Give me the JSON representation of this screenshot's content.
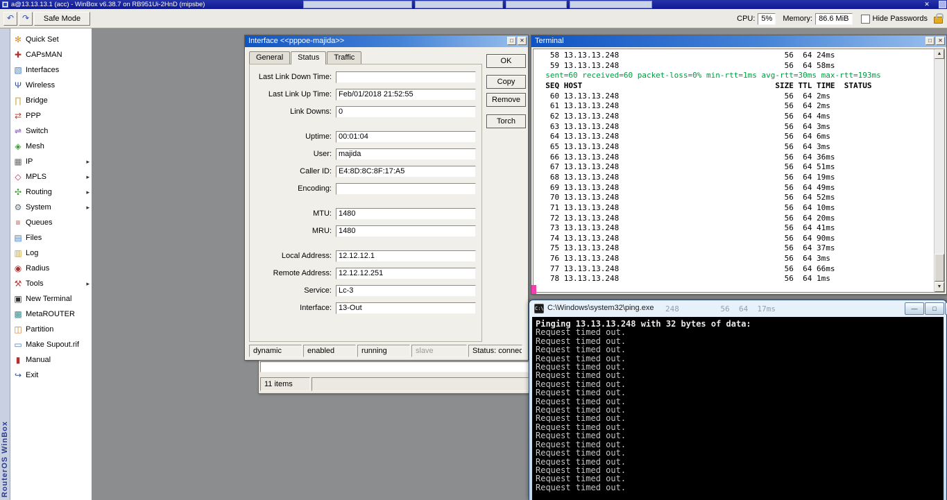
{
  "title_bar": {
    "title": "a@13.13.13.1 (acc) - WinBox v6.38.7 on RB951Ui-2HnD (mipsbe)"
  },
  "toolbar": {
    "safe_mode_label": "Safe Mode",
    "cpu_label": "CPU:",
    "cpu_value": "5%",
    "memory_label": "Memory:",
    "memory_value": "86.6 MiB",
    "hide_passwords_label": "Hide Passwords"
  },
  "brand": {
    "vertical_text": "RouterOS WinBox"
  },
  "sidebar": {
    "items": [
      {
        "label": "Quick Set",
        "icon": "quickset-icon",
        "glyph": "✻",
        "color": "#d88f2a",
        "has_submenu": false
      },
      {
        "label": "CAPsMAN",
        "icon": "capsman-icon",
        "glyph": "✚",
        "color": "#b03030",
        "has_submenu": false
      },
      {
        "label": "Interfaces",
        "icon": "interfaces-icon",
        "glyph": "▧",
        "color": "#3f7ec0",
        "has_submenu": false
      },
      {
        "label": "Wireless",
        "icon": "wireless-icon",
        "glyph": "Ψ",
        "color": "#2b4fa0",
        "has_submenu": false
      },
      {
        "label": "Bridge",
        "icon": "bridge-icon",
        "glyph": "∏",
        "color": "#caa23a",
        "has_submenu": false
      },
      {
        "label": "PPP",
        "icon": "ppp-icon",
        "glyph": "⇄",
        "color": "#b04a3a",
        "has_submenu": false
      },
      {
        "label": "Switch",
        "icon": "switch-icon",
        "glyph": "⇌",
        "color": "#7a4fb0",
        "has_submenu": false
      },
      {
        "label": "Mesh",
        "icon": "mesh-icon",
        "glyph": "◈",
        "color": "#3f9c35",
        "has_submenu": false
      },
      {
        "label": "IP",
        "icon": "ip-icon",
        "glyph": "▦",
        "color": "#6a6a6a",
        "has_submenu": true
      },
      {
        "label": "MPLS",
        "icon": "mpls-icon",
        "glyph": "◇",
        "color": "#b03060",
        "has_submenu": true
      },
      {
        "label": "Routing",
        "icon": "routing-icon",
        "glyph": "✣",
        "color": "#3f9c35",
        "has_submenu": true
      },
      {
        "label": "System",
        "icon": "system-icon",
        "glyph": "⚙",
        "color": "#5a6a7a",
        "has_submenu": true
      },
      {
        "label": "Queues",
        "icon": "queues-icon",
        "glyph": "≡",
        "color": "#b04a3a",
        "has_submenu": false
      },
      {
        "label": "Files",
        "icon": "files-icon",
        "glyph": "▤",
        "color": "#3f7ec0",
        "has_submenu": false
      },
      {
        "label": "Log",
        "icon": "log-icon",
        "glyph": "▥",
        "color": "#caa23a",
        "has_submenu": false
      },
      {
        "label": "Radius",
        "icon": "radius-icon",
        "glyph": "◉",
        "color": "#b03030",
        "has_submenu": false
      },
      {
        "label": "Tools",
        "icon": "tools-icon",
        "glyph": "⚒",
        "color": "#c23b3b",
        "has_submenu": true
      },
      {
        "label": "New Terminal",
        "icon": "terminal-icon",
        "glyph": "▣",
        "color": "#303030",
        "has_submenu": false
      },
      {
        "label": "MetaROUTER",
        "icon": "metarouter-icon",
        "glyph": "▩",
        "color": "#3a8a8a",
        "has_submenu": false
      },
      {
        "label": "Partition",
        "icon": "partition-icon",
        "glyph": "◫",
        "color": "#d07a2a",
        "has_submenu": false
      },
      {
        "label": "Make Supout.rif",
        "icon": "supout-icon",
        "glyph": "▭",
        "color": "#3f7ec0",
        "has_submenu": false
      },
      {
        "label": "Manual",
        "icon": "manual-icon",
        "glyph": "▮",
        "color": "#b03030",
        "has_submenu": false
      },
      {
        "label": "Exit",
        "icon": "exit-icon",
        "glyph": "↪",
        "color": "#2b4fa0",
        "has_submenu": false
      }
    ]
  },
  "interface_dialog": {
    "title": "Interface <<pppoe-majida>>",
    "tabs": [
      {
        "label": "General",
        "active": false
      },
      {
        "label": "Status",
        "active": true
      },
      {
        "label": "Traffic",
        "active": false
      }
    ],
    "action_buttons": [
      "OK",
      "Copy",
      "Remove",
      "Torch"
    ],
    "fields": [
      {
        "label": "Last Link Down Time:",
        "value": ""
      },
      {
        "label": "Last Link Up Time:",
        "value": "Feb/01/2018 21:52:55"
      },
      {
        "label": "Link Downs:",
        "value": "0"
      },
      {
        "label": "Uptime:",
        "value": "00:01:04"
      },
      {
        "label": "User:",
        "value": "majida"
      },
      {
        "label": "Caller ID:",
        "value": "E4:8D:8C:8F:17:A5"
      },
      {
        "label": "Encoding:",
        "value": ""
      },
      {
        "label": "MTU:",
        "value": "1480"
      },
      {
        "label": "MRU:",
        "value": "1480"
      },
      {
        "label": "Local Address:",
        "value": "12.12.12.1"
      },
      {
        "label": "Remote Address:",
        "value": "12.12.12.251"
      },
      {
        "label": "Service:",
        "value": "Lc-3"
      },
      {
        "label": "Interface:",
        "value": "13-Out"
      }
    ],
    "footer_flags": [
      {
        "label": "dynamic",
        "muted": false
      },
      {
        "label": "enabled",
        "muted": false
      },
      {
        "label": "running",
        "muted": false
      },
      {
        "label": "slave",
        "muted": true
      },
      {
        "label": "Status: connected",
        "muted": false
      }
    ]
  },
  "ppp_window_fragment": {
    "items_count": "11 items"
  },
  "terminal_window": {
    "title": "Terminal",
    "host": "13.13.13.248",
    "columns": {
      "seq": "SEQ",
      "host": "HOST",
      "size": "SIZE",
      "ttl": "TTL",
      "time": "TIME",
      "status": "STATUS"
    },
    "rows_before_summary": [
      {
        "seq": 58,
        "size": 56,
        "ttl": 64,
        "time": "24ms"
      },
      {
        "seq": 59,
        "size": 56,
        "ttl": 64,
        "time": "58ms"
      }
    ],
    "summary_line": "sent=60 received=60 packet-loss=0% min-rtt=1ms avg-rtt=30ms max-rtt=193ms",
    "rows": [
      {
        "seq": 60,
        "size": 56,
        "ttl": 64,
        "time": "2ms"
      },
      {
        "seq": 61,
        "size": 56,
        "ttl": 64,
        "time": "2ms"
      },
      {
        "seq": 62,
        "size": 56,
        "ttl": 64,
        "time": "4ms"
      },
      {
        "seq": 63,
        "size": 56,
        "ttl": 64,
        "time": "3ms"
      },
      {
        "seq": 64,
        "size": 56,
        "ttl": 64,
        "time": "6ms"
      },
      {
        "seq": 65,
        "size": 56,
        "ttl": 64,
        "time": "3ms"
      },
      {
        "seq": 66,
        "size": 56,
        "ttl": 64,
        "time": "36ms"
      },
      {
        "seq": 67,
        "size": 56,
        "ttl": 64,
        "time": "51ms"
      },
      {
        "seq": 68,
        "size": 56,
        "ttl": 64,
        "time": "19ms"
      },
      {
        "seq": 69,
        "size": 56,
        "ttl": 64,
        "time": "49ms"
      },
      {
        "seq": 70,
        "size": 56,
        "ttl": 64,
        "time": "52ms"
      },
      {
        "seq": 71,
        "size": 56,
        "ttl": 64,
        "time": "10ms"
      },
      {
        "seq": 72,
        "size": 56,
        "ttl": 64,
        "time": "20ms"
      },
      {
        "seq": 73,
        "size": 56,
        "ttl": 64,
        "time": "41ms"
      },
      {
        "seq": 74,
        "size": 56,
        "ttl": 64,
        "time": "90ms"
      },
      {
        "seq": 75,
        "size": 56,
        "ttl": 64,
        "time": "37ms"
      },
      {
        "seq": 76,
        "size": 56,
        "ttl": 64,
        "time": "3ms"
      },
      {
        "seq": 77,
        "size": 56,
        "ttl": 64,
        "time": "66ms"
      },
      {
        "seq": 78,
        "size": 56,
        "ttl": 64,
        "time": "1ms"
      }
    ]
  },
  "ping_window": {
    "title": "C:\\Windows\\system32\\ping.exe",
    "glass_fragment": "248         56  64  17ms",
    "intro_line": "Pinging 13.13.13.248 with 32 bytes of data:",
    "timeout_line": "Request timed out.",
    "timeout_count": 19
  },
  "colors": {
    "terminal_green": "#009a40",
    "console_background": "#000000",
    "console_text": "#c6c6c6"
  }
}
